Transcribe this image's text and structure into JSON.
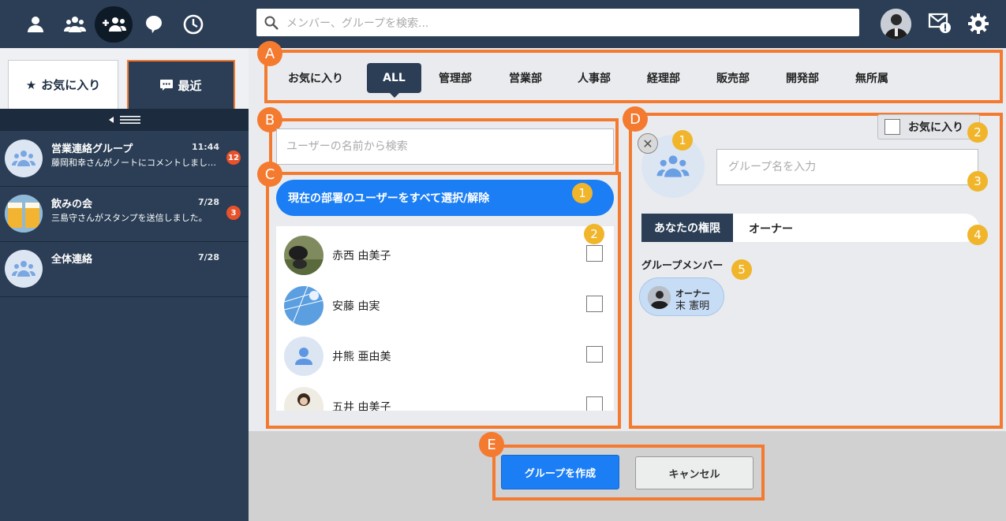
{
  "topbar": {
    "nav": [
      {
        "icon": "person-icon",
        "active": false
      },
      {
        "icon": "users-icon",
        "active": false
      },
      {
        "icon": "group-add-icon",
        "active": true
      },
      {
        "icon": "chat-bubble-icon",
        "active": false
      },
      {
        "icon": "clock-icon",
        "active": false
      }
    ],
    "search_placeholder": "メンバー、グループを検索...",
    "right_icons": [
      "user-avatar",
      "mail-alert-icon",
      "gear-icon"
    ]
  },
  "sidebar": {
    "tabs": {
      "favorites": "お気に入り",
      "recent": "最近"
    },
    "chats": [
      {
        "name": "営業連絡グループ",
        "time": "11:44",
        "preview": "藤岡和幸さんがノートにコメントしまし…",
        "badge": "12",
        "avatar": "group"
      },
      {
        "name": "飲みの会",
        "time": "7/28",
        "preview": "三島守さんがスタンプを送信しました。",
        "badge": "3",
        "avatar": "beer"
      },
      {
        "name": "全体連絡",
        "time": "7/28",
        "preview": "",
        "badge": "",
        "avatar": "group"
      }
    ]
  },
  "annotations": {
    "A": "A",
    "B": "B",
    "C": "C",
    "D": "D",
    "E": "E",
    "n1": "1",
    "n2": "2",
    "n3": "3",
    "n4": "4",
    "n5": "5"
  },
  "departments": [
    "お気に入り",
    "ALL",
    "管理部",
    "営業部",
    "人事部",
    "経理部",
    "販売部",
    "開発部",
    "無所属"
  ],
  "user_search_placeholder": "ユーザーの名前から検索",
  "select_all_label": "現在の部署のユーザーをすべて選択/解除",
  "users": [
    {
      "name": "赤西 由美子",
      "avatar": "dog-photo"
    },
    {
      "name": "安藤 由実",
      "avatar": "sky-photo"
    },
    {
      "name": "井熊 亜由美",
      "avatar": "default-person"
    },
    {
      "name": "五井 由美子",
      "avatar": "person-photo"
    }
  ],
  "group": {
    "favorite_label": "お気に入り",
    "name_placeholder": "グループ名を入力",
    "permission_label": "あなたの権限",
    "permission_value": "オーナー",
    "members_label": "グループメンバー",
    "members": [
      {
        "role": "オーナー",
        "name": "末 憲明"
      }
    ]
  },
  "buttons": {
    "create": "グループを作成",
    "cancel": "キャンセル"
  },
  "colors": {
    "navy": "#2b3e55",
    "accent_orange": "#f47a30",
    "primary_blue": "#1b7ef5",
    "badge_red": "#e8522a",
    "number_yellow": "#f0b52b"
  }
}
